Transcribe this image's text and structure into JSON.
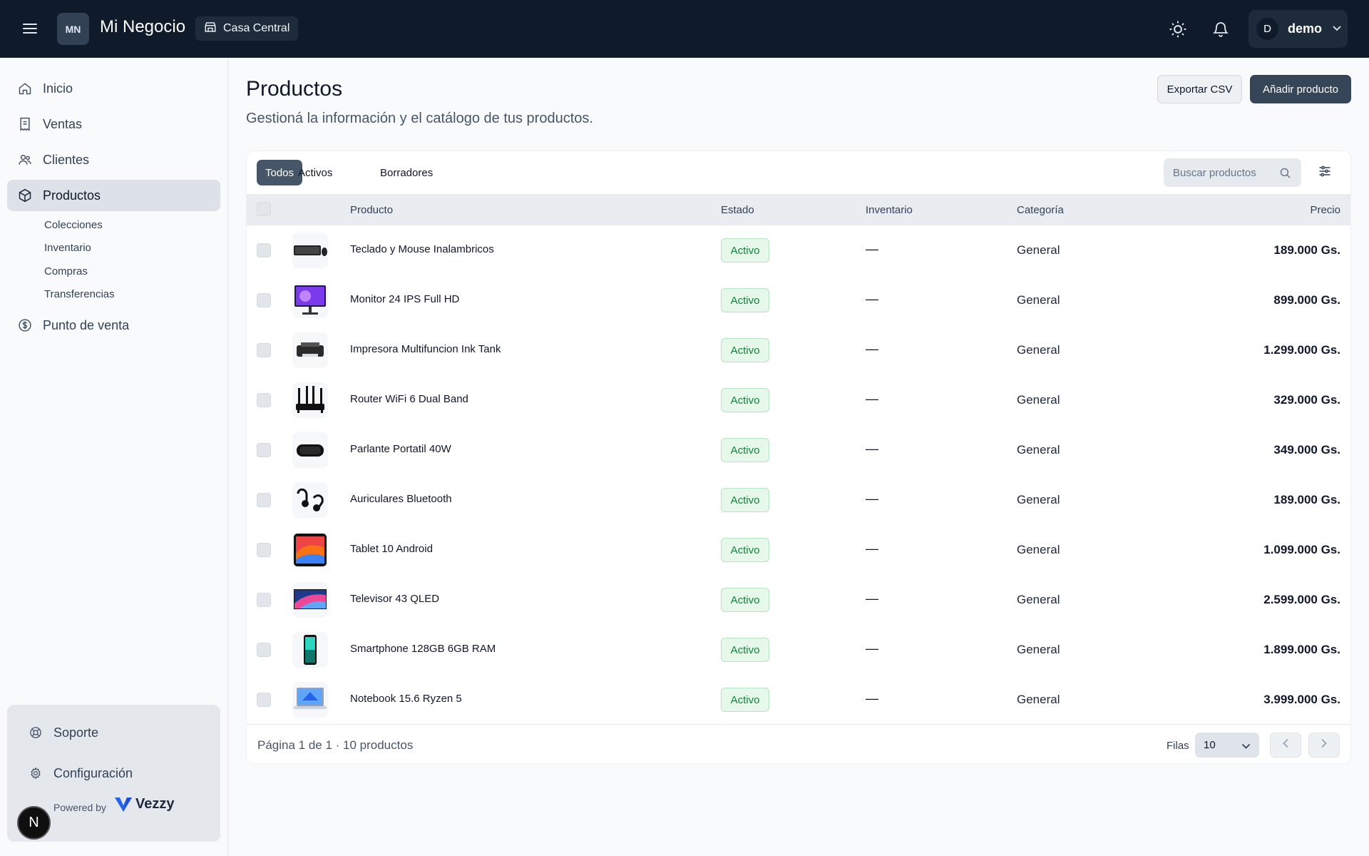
{
  "header": {
    "logo_initials": "MN",
    "app_name": "Mi Negocio",
    "branch": "Casa Central",
    "user_initial": "D",
    "user_name": "demo"
  },
  "sidebar": {
    "items": [
      {
        "label": "Inicio",
        "icon": "home-icon"
      },
      {
        "label": "Ventas",
        "icon": "receipt-icon"
      },
      {
        "label": "Clientes",
        "icon": "users-icon"
      },
      {
        "label": "Productos",
        "icon": "box-icon",
        "active": true
      },
      {
        "label": "Punto de venta",
        "icon": "dollar-circle-icon"
      }
    ],
    "subitems": [
      "Colecciones",
      "Inventario",
      "Compras",
      "Transferencias"
    ],
    "footer": {
      "support": "Soporte",
      "settings": "Configuración",
      "powered_by": "Powered by",
      "brand": "Vezzy"
    },
    "n_badge": "N"
  },
  "page": {
    "title": "Productos",
    "subtitle": "Gestioná la información y el catálogo de tus productos.",
    "export_label": "Exportar CSV",
    "add_label": "Añadir producto"
  },
  "tabs": [
    "Todos",
    "Activos",
    "Borradores"
  ],
  "search": {
    "placeholder": "Buscar productos"
  },
  "table": {
    "columns": {
      "product": "Producto",
      "status": "Estado",
      "inventory": "Inventario",
      "category": "Categoría",
      "price": "Precio"
    },
    "rows": [
      {
        "name": "Teclado y Mouse Inalambricos",
        "status": "Activo",
        "inventory": "—",
        "category": "General",
        "price": "189.000 Gs.",
        "thumb": "keyboard"
      },
      {
        "name": "Monitor 24 IPS Full HD",
        "status": "Activo",
        "inventory": "—",
        "category": "General",
        "price": "899.000 Gs.",
        "thumb": "monitor"
      },
      {
        "name": "Impresora Multifuncion Ink Tank",
        "status": "Activo",
        "inventory": "—",
        "category": "General",
        "price": "1.299.000 Gs.",
        "thumb": "printer"
      },
      {
        "name": "Router WiFi 6 Dual Band",
        "status": "Activo",
        "inventory": "—",
        "category": "General",
        "price": "329.000 Gs.",
        "thumb": "router"
      },
      {
        "name": "Parlante Portatil 40W",
        "status": "Activo",
        "inventory": "—",
        "category": "General",
        "price": "349.000 Gs.",
        "thumb": "speaker"
      },
      {
        "name": "Auriculares Bluetooth",
        "status": "Activo",
        "inventory": "—",
        "category": "General",
        "price": "189.000 Gs.",
        "thumb": "earbuds"
      },
      {
        "name": "Tablet 10 Android",
        "status": "Activo",
        "inventory": "—",
        "category": "General",
        "price": "1.099.000 Gs.",
        "thumb": "tablet"
      },
      {
        "name": "Televisor 43 QLED",
        "status": "Activo",
        "inventory": "—",
        "category": "General",
        "price": "2.599.000 Gs.",
        "thumb": "tv"
      },
      {
        "name": "Smartphone 128GB 6GB RAM",
        "status": "Activo",
        "inventory": "—",
        "category": "General",
        "price": "1.899.000 Gs.",
        "thumb": "phone"
      },
      {
        "name": "Notebook 15.6 Ryzen 5",
        "status": "Activo",
        "inventory": "—",
        "category": "General",
        "price": "3.999.000 Gs.",
        "thumb": "laptop"
      }
    ]
  },
  "pagination": {
    "info": "Página 1 de 1 · 10 productos",
    "rows_label": "Filas",
    "rows_value": "10"
  },
  "colors": {
    "topbar": "#0f1b2a",
    "accent": "#374558",
    "active_badge": "#15803d"
  }
}
